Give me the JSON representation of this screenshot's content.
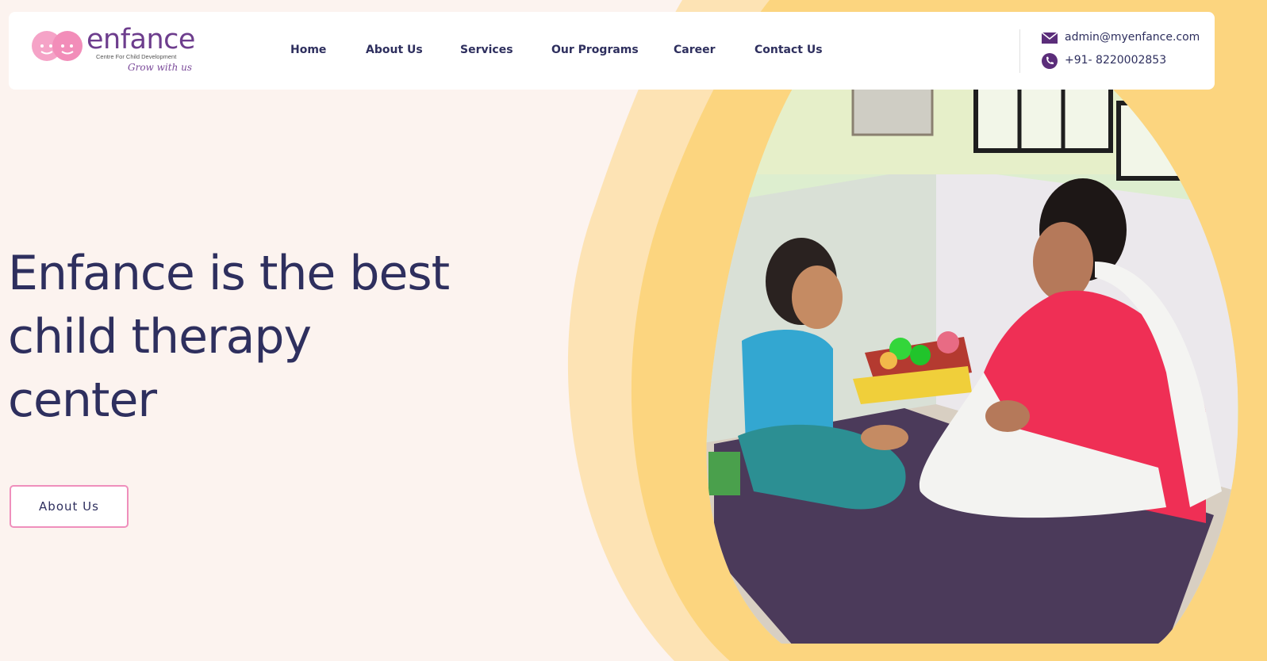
{
  "brand": {
    "name": "enfance",
    "tagline": "Centre For Child Development",
    "slogan": "Grow with us",
    "colors": {
      "primary": "#2e2f5e",
      "accent_pink": "#ef8fbc",
      "accent_yellow": "#fcd57f",
      "logo_purple": "#6d3d8d"
    }
  },
  "nav": {
    "items": [
      {
        "label": "Home"
      },
      {
        "label": "About Us"
      },
      {
        "label": "Services"
      },
      {
        "label": "Our Programs"
      },
      {
        "label": "Career"
      },
      {
        "label": "Contact Us"
      }
    ]
  },
  "contact": {
    "email": {
      "icon": "mail-icon",
      "text": "admin@myenfance.com"
    },
    "phone": {
      "icon": "phone-icon",
      "text": "+91- 8220002853"
    }
  },
  "hero": {
    "title_lines": [
      "Enfance is the best",
      "child therapy",
      "center"
    ],
    "button_label": "About Us",
    "image_icon": "therapy-session-photo"
  }
}
